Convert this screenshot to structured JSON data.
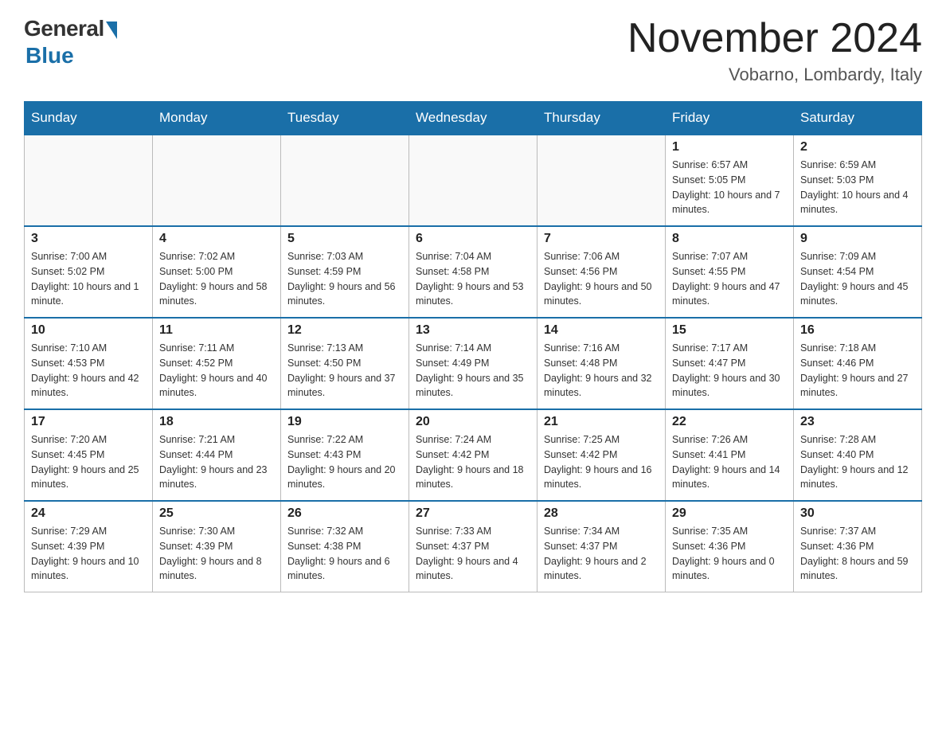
{
  "header": {
    "logo_general": "General",
    "logo_blue": "Blue",
    "month_title": "November 2024",
    "location": "Vobarno, Lombardy, Italy"
  },
  "days_of_week": [
    "Sunday",
    "Monday",
    "Tuesday",
    "Wednesday",
    "Thursday",
    "Friday",
    "Saturday"
  ],
  "weeks": [
    [
      {
        "day": "",
        "info": ""
      },
      {
        "day": "",
        "info": ""
      },
      {
        "day": "",
        "info": ""
      },
      {
        "day": "",
        "info": ""
      },
      {
        "day": "",
        "info": ""
      },
      {
        "day": "1",
        "info": "Sunrise: 6:57 AM\nSunset: 5:05 PM\nDaylight: 10 hours and 7 minutes."
      },
      {
        "day": "2",
        "info": "Sunrise: 6:59 AM\nSunset: 5:03 PM\nDaylight: 10 hours and 4 minutes."
      }
    ],
    [
      {
        "day": "3",
        "info": "Sunrise: 7:00 AM\nSunset: 5:02 PM\nDaylight: 10 hours and 1 minute."
      },
      {
        "day": "4",
        "info": "Sunrise: 7:02 AM\nSunset: 5:00 PM\nDaylight: 9 hours and 58 minutes."
      },
      {
        "day": "5",
        "info": "Sunrise: 7:03 AM\nSunset: 4:59 PM\nDaylight: 9 hours and 56 minutes."
      },
      {
        "day": "6",
        "info": "Sunrise: 7:04 AM\nSunset: 4:58 PM\nDaylight: 9 hours and 53 minutes."
      },
      {
        "day": "7",
        "info": "Sunrise: 7:06 AM\nSunset: 4:56 PM\nDaylight: 9 hours and 50 minutes."
      },
      {
        "day": "8",
        "info": "Sunrise: 7:07 AM\nSunset: 4:55 PM\nDaylight: 9 hours and 47 minutes."
      },
      {
        "day": "9",
        "info": "Sunrise: 7:09 AM\nSunset: 4:54 PM\nDaylight: 9 hours and 45 minutes."
      }
    ],
    [
      {
        "day": "10",
        "info": "Sunrise: 7:10 AM\nSunset: 4:53 PM\nDaylight: 9 hours and 42 minutes."
      },
      {
        "day": "11",
        "info": "Sunrise: 7:11 AM\nSunset: 4:52 PM\nDaylight: 9 hours and 40 minutes."
      },
      {
        "day": "12",
        "info": "Sunrise: 7:13 AM\nSunset: 4:50 PM\nDaylight: 9 hours and 37 minutes."
      },
      {
        "day": "13",
        "info": "Sunrise: 7:14 AM\nSunset: 4:49 PM\nDaylight: 9 hours and 35 minutes."
      },
      {
        "day": "14",
        "info": "Sunrise: 7:16 AM\nSunset: 4:48 PM\nDaylight: 9 hours and 32 minutes."
      },
      {
        "day": "15",
        "info": "Sunrise: 7:17 AM\nSunset: 4:47 PM\nDaylight: 9 hours and 30 minutes."
      },
      {
        "day": "16",
        "info": "Sunrise: 7:18 AM\nSunset: 4:46 PM\nDaylight: 9 hours and 27 minutes."
      }
    ],
    [
      {
        "day": "17",
        "info": "Sunrise: 7:20 AM\nSunset: 4:45 PM\nDaylight: 9 hours and 25 minutes."
      },
      {
        "day": "18",
        "info": "Sunrise: 7:21 AM\nSunset: 4:44 PM\nDaylight: 9 hours and 23 minutes."
      },
      {
        "day": "19",
        "info": "Sunrise: 7:22 AM\nSunset: 4:43 PM\nDaylight: 9 hours and 20 minutes."
      },
      {
        "day": "20",
        "info": "Sunrise: 7:24 AM\nSunset: 4:42 PM\nDaylight: 9 hours and 18 minutes."
      },
      {
        "day": "21",
        "info": "Sunrise: 7:25 AM\nSunset: 4:42 PM\nDaylight: 9 hours and 16 minutes."
      },
      {
        "day": "22",
        "info": "Sunrise: 7:26 AM\nSunset: 4:41 PM\nDaylight: 9 hours and 14 minutes."
      },
      {
        "day": "23",
        "info": "Sunrise: 7:28 AM\nSunset: 4:40 PM\nDaylight: 9 hours and 12 minutes."
      }
    ],
    [
      {
        "day": "24",
        "info": "Sunrise: 7:29 AM\nSunset: 4:39 PM\nDaylight: 9 hours and 10 minutes."
      },
      {
        "day": "25",
        "info": "Sunrise: 7:30 AM\nSunset: 4:39 PM\nDaylight: 9 hours and 8 minutes."
      },
      {
        "day": "26",
        "info": "Sunrise: 7:32 AM\nSunset: 4:38 PM\nDaylight: 9 hours and 6 minutes."
      },
      {
        "day": "27",
        "info": "Sunrise: 7:33 AM\nSunset: 4:37 PM\nDaylight: 9 hours and 4 minutes."
      },
      {
        "day": "28",
        "info": "Sunrise: 7:34 AM\nSunset: 4:37 PM\nDaylight: 9 hours and 2 minutes."
      },
      {
        "day": "29",
        "info": "Sunrise: 7:35 AM\nSunset: 4:36 PM\nDaylight: 9 hours and 0 minutes."
      },
      {
        "day": "30",
        "info": "Sunrise: 7:37 AM\nSunset: 4:36 PM\nDaylight: 8 hours and 59 minutes."
      }
    ]
  ]
}
